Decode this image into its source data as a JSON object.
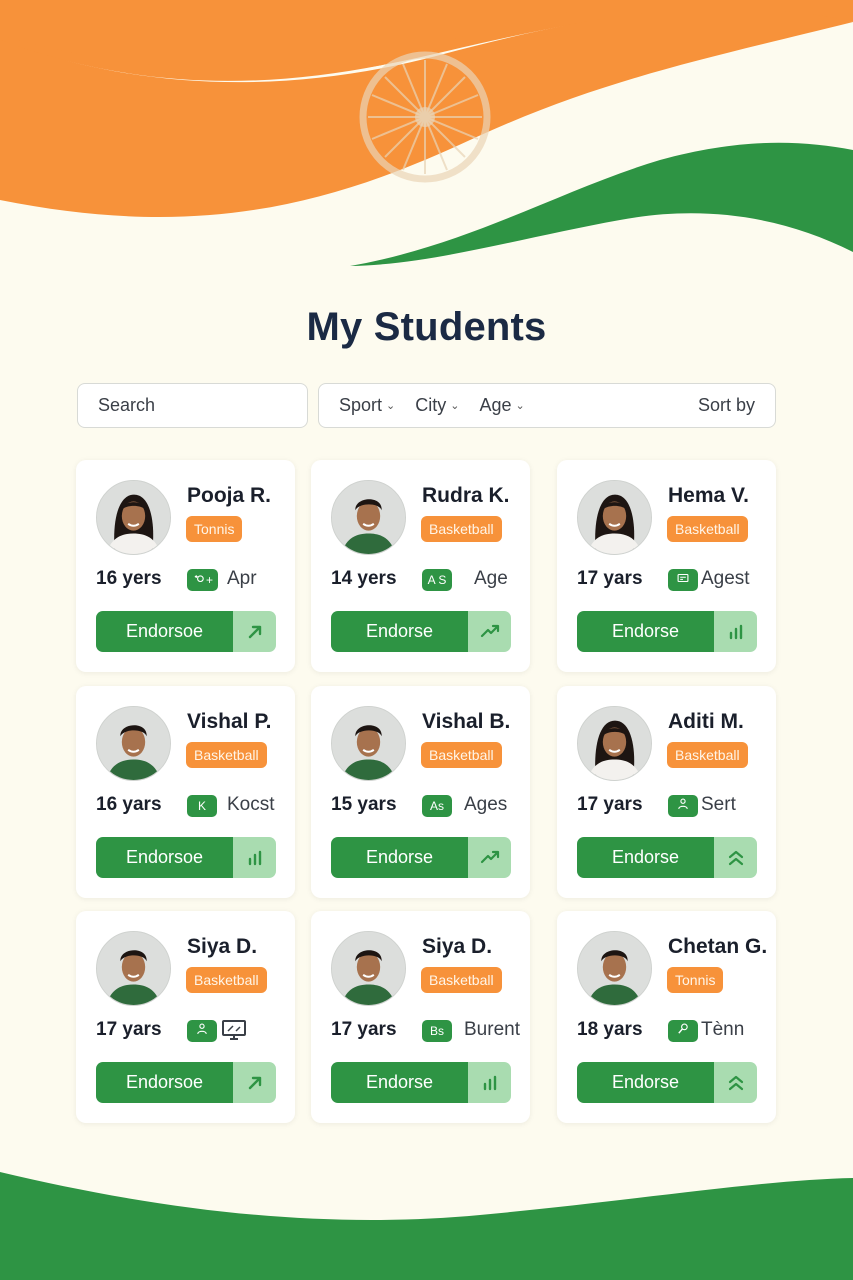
{
  "page": {
    "title": "My Students"
  },
  "search": {
    "placeholder": "Search"
  },
  "filters": [
    {
      "label": "Sport"
    },
    {
      "label": "City"
    },
    {
      "label": "Age"
    }
  ],
  "sort": {
    "label": "Sort by"
  },
  "button_label": "Endorse",
  "colors": {
    "saffron": "#f7923a",
    "green": "#2e9444",
    "green_light": "#a9dcb0",
    "navy": "#1b2a44",
    "background": "#fdfbef"
  },
  "students": [
    {
      "name": "Pooja R.",
      "sport": "Tonnis",
      "age": "16 yers",
      "badge": "+",
      "badge_icon": "medal-icon",
      "meta": "Apr",
      "button": "Endorsoe",
      "trend_icon": "arrow-up-right-icon",
      "avatar": "female"
    },
    {
      "name": "Rudra K.",
      "sport": "Basketball",
      "age": "14 yers",
      "badge": "A S",
      "meta": "Age",
      "button": "Endorse",
      "trend_icon": "trending-up-icon",
      "avatar": "male"
    },
    {
      "name": "Hema V.",
      "sport": "Basketball",
      "age": "17 yars",
      "badge": "",
      "badge_icon": "card-icon",
      "meta": "Agest",
      "button": "Endorse",
      "trend_icon": "bar-chart-icon",
      "avatar": "female"
    },
    {
      "name": "Vishal P.",
      "sport": "Basketball",
      "age": "16 yars",
      "badge": "K",
      "meta": "Kocst",
      "button": "Endorsoe",
      "trend_icon": "bar-chart-icon",
      "avatar": "male"
    },
    {
      "name": "Vishal B.",
      "sport": "Basketball",
      "age": "15 yars",
      "badge": "As",
      "meta": "Ages",
      "button": "Endorse",
      "trend_icon": "trending-up-icon",
      "avatar": "male"
    },
    {
      "name": "Aditi M.",
      "sport": "Basketball",
      "age": "17 yars",
      "badge": "",
      "badge_icon": "person-icon",
      "meta": "Sert",
      "button": "Endorse",
      "trend_icon": "chevrons-up-icon",
      "avatar": "female"
    },
    {
      "name": "Siya D.",
      "sport": "Basketball",
      "age": "17 yars",
      "badge": "",
      "badge_icon": "person-icon",
      "extra_icon": "monitor-icon",
      "meta": "",
      "button": "Endorsoe",
      "trend_icon": "arrow-up-right-icon",
      "avatar": "male"
    },
    {
      "name": "Siya D.",
      "sport": "Basketball",
      "age": "17 yars",
      "badge": "Bs",
      "meta": "Burent",
      "button": "Endorse",
      "trend_icon": "bar-chart-icon",
      "avatar": "male"
    },
    {
      "name": "Chetan G.",
      "sport": "Tonnis",
      "age": "18 yars",
      "badge": "",
      "badge_icon": "racket-icon",
      "meta": "Tènn",
      "button": "Endorse",
      "trend_icon": "chevrons-up-icon",
      "avatar": "male"
    }
  ]
}
